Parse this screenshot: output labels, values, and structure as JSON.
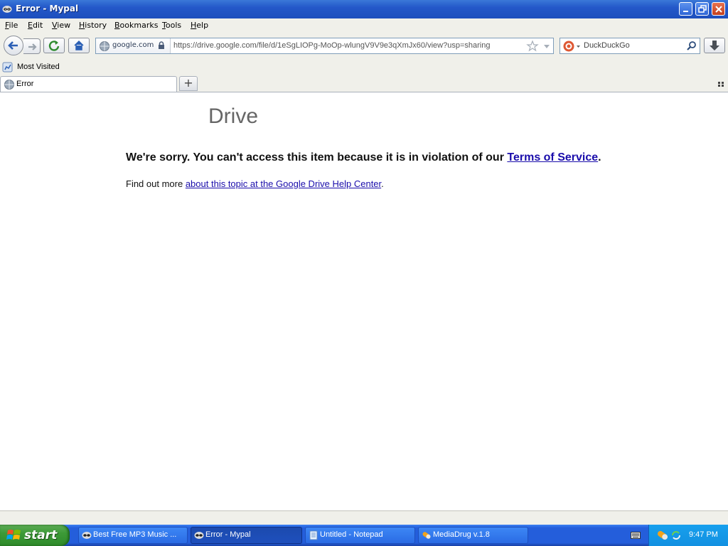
{
  "window": {
    "title": "Error - Mypal"
  },
  "menu": [
    "File",
    "Edit",
    "View",
    "History",
    "Bookmarks",
    "Tools",
    "Help"
  ],
  "navbar": {
    "identity_host": "google.com",
    "url": "https://drive.google.com/file/d/1eSgLIOPg-MoOp-wlungV9V9e3qXmJx60/view?usp=sharing",
    "search_engine": "DuckDuckGo"
  },
  "bookmarks": {
    "most_visited": "Most Visited"
  },
  "tabs": [
    {
      "label": "Error"
    }
  ],
  "page": {
    "logo_text": "Drive",
    "error_heading_prefix": "We're sorry. You can't access this item because it is in violation of our ",
    "error_heading_link": "Terms of Service",
    "error_heading_suffix": ".",
    "help_prefix": "Find out more ",
    "help_link": "about this topic at the Google Drive Help Center",
    "help_suffix": "."
  },
  "taskbar": {
    "start_label": "start",
    "tasks": [
      {
        "label": "Best Free MP3 Music ..."
      },
      {
        "label": "Error - Mypal"
      },
      {
        "label": "Untitled - Notepad"
      },
      {
        "label": "MediaDrug v.1.8"
      }
    ],
    "clock": "9:47 PM"
  },
  "colors": {
    "link": "#1a0dab",
    "titlebar": "#2458c9",
    "taskbar": "#245edb",
    "start": "#3c9a37"
  }
}
